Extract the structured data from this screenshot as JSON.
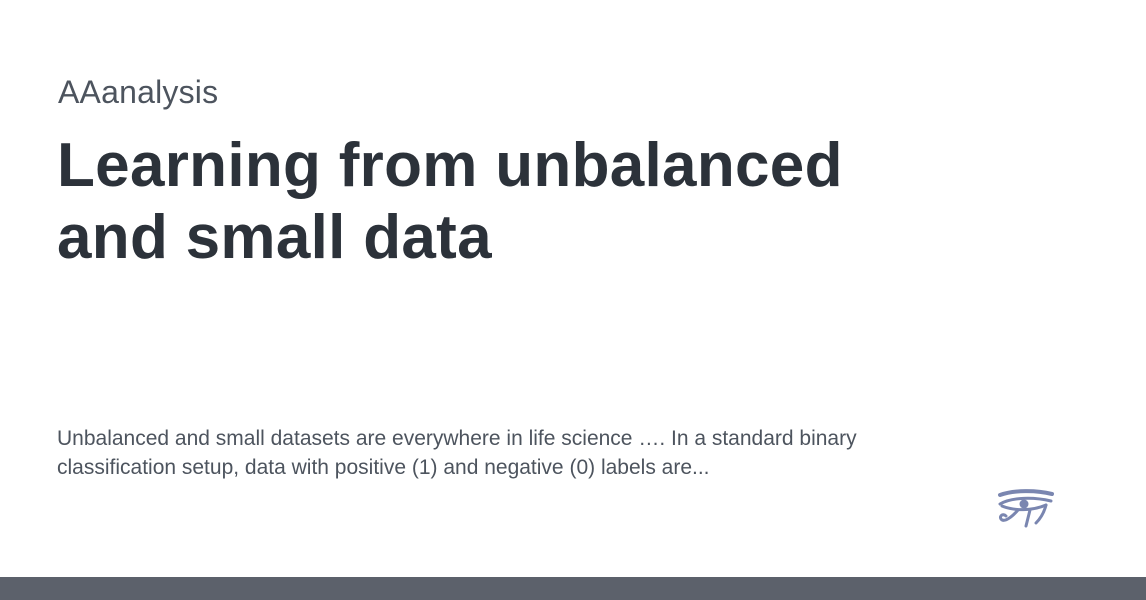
{
  "site": {
    "name": "AAanalysis"
  },
  "page": {
    "title_lines": [
      "Learning from unbalanced",
      "and small data"
    ],
    "description_lines": [
      "Unbalanced and small datasets are everywhere in life science …. In a standard binary",
      "classification setup, data with positive (1) and negative (0) labels are..."
    ]
  },
  "logo": {
    "icon": "eye-of-horus-icon",
    "color": "#7a86b0"
  },
  "colors": {
    "background": "#ffffff",
    "title": "#2c323a",
    "text": "#4d545e",
    "footer_bar": "#5c616b"
  }
}
